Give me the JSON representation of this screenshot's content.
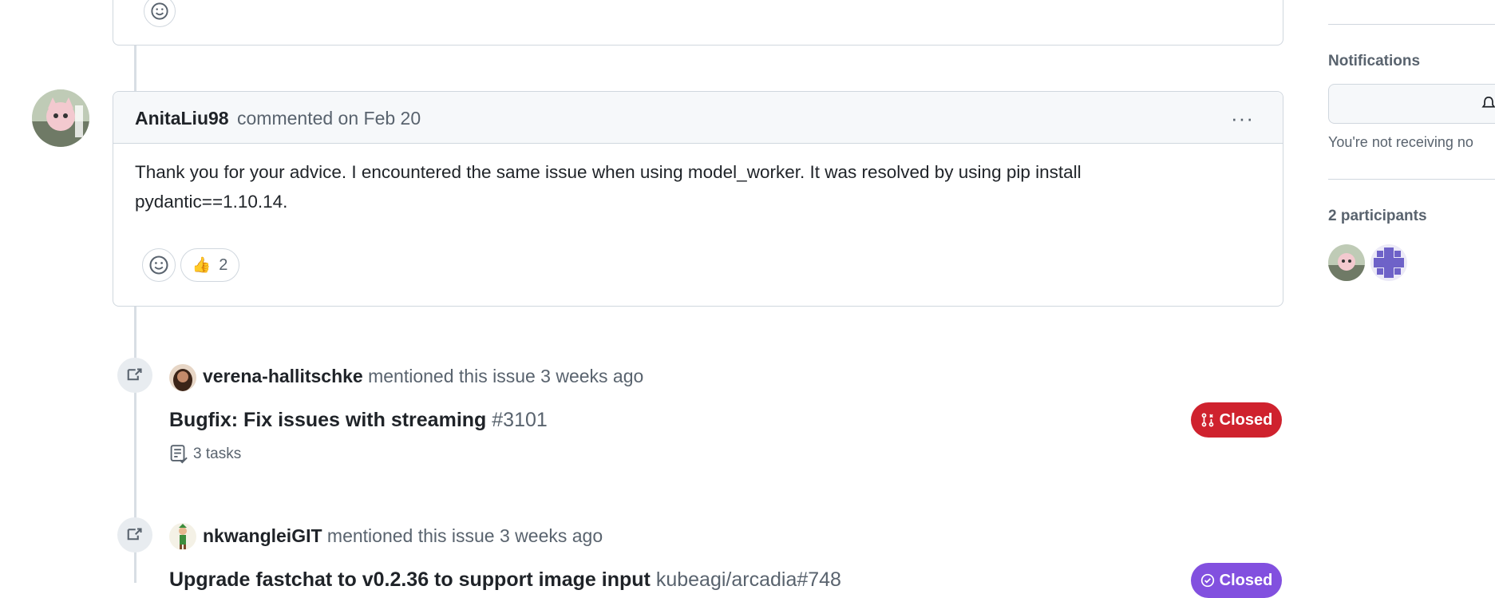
{
  "main_comment": {
    "author": "AnitaLiu98",
    "action": "commented on Feb 20",
    "menu_label": "···",
    "body_line1": "Thank you for your advice. I encountered the same issue when using model_worker. It was resolved by using pip install",
    "body_line2": "pydantic==1.10.14.",
    "reaction_emoji": "👍",
    "reaction_count": "2"
  },
  "events": [
    {
      "user": "verena-hallitschke",
      "text": "mentioned this issue 3 weeks ago",
      "ref_title": "Bugfix: Fix issues with streaming",
      "ref_number": "#3101",
      "tasks": "3 tasks",
      "status": "Closed",
      "status_color": "#cf222e"
    },
    {
      "user": "nkwangleiGIT",
      "text": "mentioned this issue 3 weeks ago",
      "ref_title": "Upgrade fastchat to v0.2.36 to support image input",
      "ref_number": "kubeagi/arcadia#748",
      "status": "Closed",
      "status_color": "#8250df"
    }
  ],
  "sidebar": {
    "notifications_heading": "Notifications",
    "notifications_note": "You're not receiving no",
    "participants_heading": "2 participants"
  }
}
